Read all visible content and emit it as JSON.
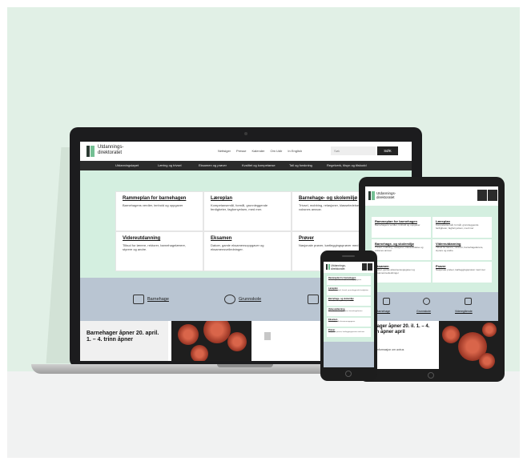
{
  "desktop": {
    "logo_text": "Utdannings-\ndirektoratet",
    "top_links": [
      "Nettsiger",
      "Presse",
      "Kalender",
      "Om Udir",
      "In English"
    ],
    "search_placeholder": "Søk",
    "search_button": "SØK",
    "nav_items": [
      "Utdanningsløpet",
      "Læring og trivsel",
      "Eksamen og prøver",
      "Kvalitet og kompetanse",
      "Tall og forskning",
      "Regelverk, tilsyn og tilskudd"
    ],
    "cards": [
      {
        "title": "Rammeplan for barnehagen",
        "desc": "Barnehagens verdier, innhold og oppgaver"
      },
      {
        "title": "Læreplan",
        "desc": "Kompetansemål, formål, grunnleggende ferdigheter, fagfornyelsen, med mer."
      },
      {
        "title": "Barnehage- og skolemiljø",
        "desc": "Trivsel, mobbing, relasjoner, klasseledelse og voksnes ansvar."
      },
      {
        "title": "Videreutdanning",
        "desc": "Tilbud for lærere, rektorer, barnehagelærere, styrere og andre."
      },
      {
        "title": "Eksamen",
        "desc": "Datoer, gamle eksamensoppgaver og eksamensveiledninger."
      },
      {
        "title": "Prøver",
        "desc": "Nasjonale prøver, kartleggingsprøver med mer."
      }
    ],
    "stages": [
      "Barnehage",
      "Grunnskole"
    ],
    "news_title": "Barnehager åpner 20. april. 1. – 4. trinn åpner"
  },
  "tablet": {
    "logo_text": "Utdannings-\ndirektoratet",
    "cards": [
      {
        "title": "Rammeplan for barnehagen",
        "desc": "Barnehagens verdier, innhold og oppgaver"
      },
      {
        "title": "Læreplan",
        "desc": "Kompetansemål, formål, grunnleggende ferdigheter, fagfornyelsen, med mer"
      },
      {
        "title": "Barnehage- og skolemiljø",
        "desc": "Trivsel, mobbing, relasjoner, klasseledelse og voksnes ansvar"
      },
      {
        "title": "Videreutdanning",
        "desc": "Tilbud for lærere, rektorer, barnehagelærere, styrere og andre"
      },
      {
        "title": "Eksamen",
        "desc": "Datoer, gamle eksamensoppgaver og eksamensveiledninger"
      },
      {
        "title": "Prøver",
        "desc": "Nasjonale prøver, kartleggingsprøver med mer"
      }
    ],
    "stages": [
      "Barnehage",
      "Grunnskole",
      "Videregående"
    ],
    "news_title": "nehager åpner 20. il. 1. – 4. trinn åpner april",
    "news_sub": "sjonal informasjon om avirus"
  },
  "phone": {
    "logo_text": "Utdannings-\ndirektoratet",
    "cards": [
      {
        "title": "Rammeplan for barnehagen",
        "desc": "Barnehagens verdier, innhold og oppgaver"
      },
      {
        "title": "Læreplan",
        "desc": "Kompetansemål, formål, grunnleggende ferdigheter"
      },
      {
        "title": "Barnehage- og skolemiljø",
        "desc": "Trivsel, mobbing, relasjoner"
      },
      {
        "title": "Videreutdanning",
        "desc": "Tilbud for lærere, rektorer, barnehagelærere"
      },
      {
        "title": "Eksamen",
        "desc": "Datoer, gamle eksamensoppgaver"
      },
      {
        "title": "Prøver",
        "desc": "Nasjonale prøver, kartleggingsprøver med mer"
      }
    ]
  },
  "colors": {
    "background": "#e1f0e6",
    "hero": "#d4efe0",
    "stages": "#b9c5d2",
    "nav": "#2b2b2b",
    "logo_green": "#74c094"
  }
}
